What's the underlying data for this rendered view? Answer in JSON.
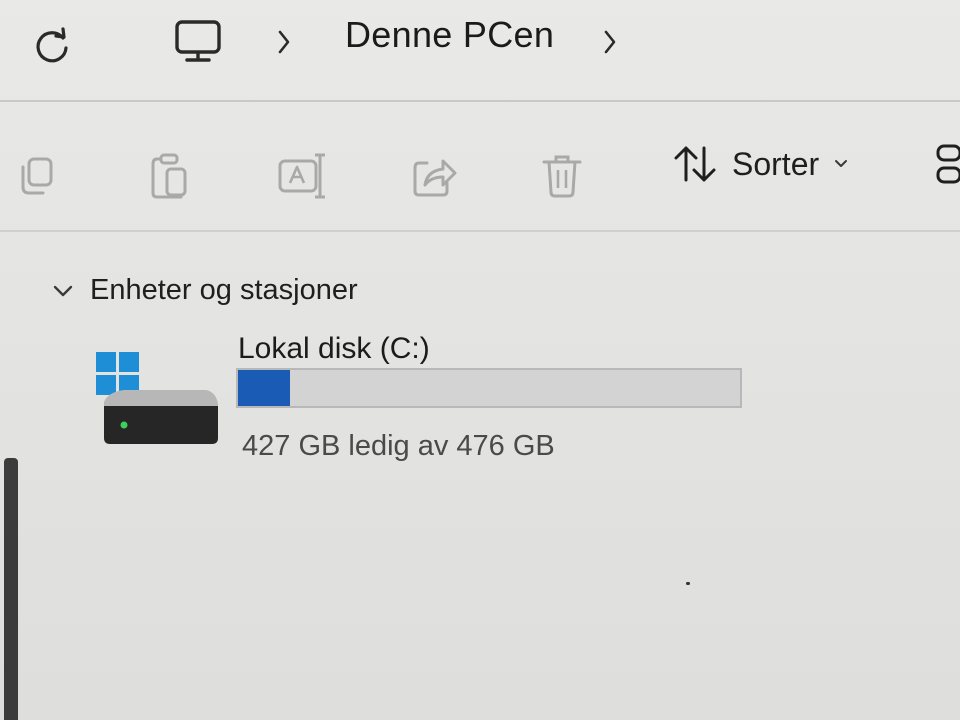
{
  "address_bar": {
    "refresh_icon": "refresh-icon",
    "pc_icon": "computer-monitor-icon",
    "current_location": "Denne PCen"
  },
  "command_bar": {
    "copy_icon": "copy-icon",
    "paste_icon": "paste-icon",
    "rename_icon": "rename-icon",
    "share_icon": "share-icon",
    "delete_icon": "delete-icon",
    "sort_label": "Sorter",
    "sort_icon": "sort-arrows-icon",
    "more_icon": "more-options-icon"
  },
  "content": {
    "group_title": "Enheter og stasjoner",
    "drive": {
      "name": "Lokal disk (C:)",
      "free_text": "427 GB ledig av 476 GB",
      "used_fraction": 0.103,
      "icon": "windows-drive-icon"
    }
  },
  "colors": {
    "accent_fill": "#1a5bb5",
    "bar_background": "#d3d3d3",
    "windows_logo": "#1e8fd6"
  }
}
